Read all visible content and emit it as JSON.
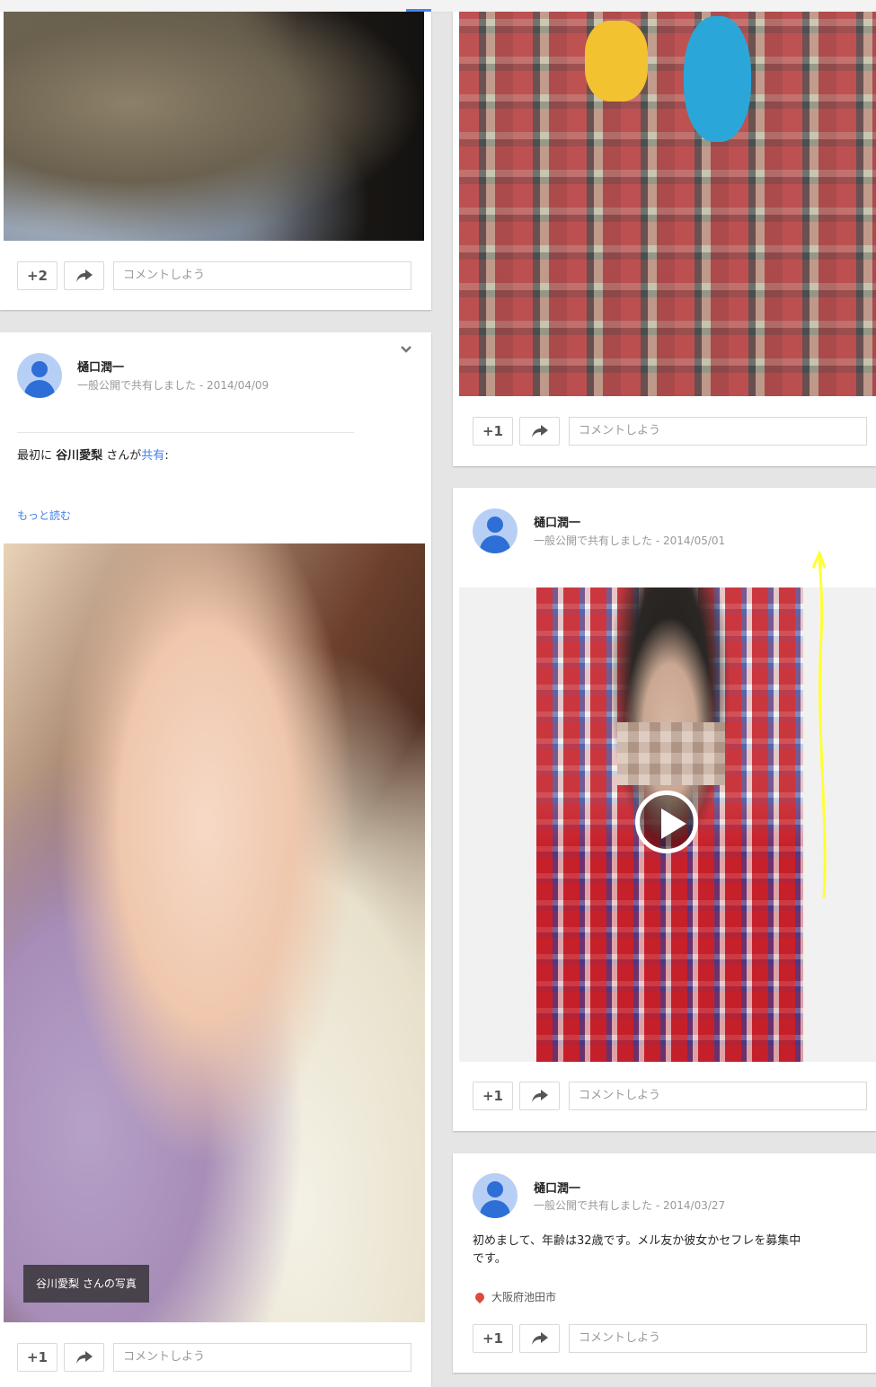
{
  "posts": {
    "p1": {
      "plus_label": "+2",
      "comment_placeholder": "コメントしよう"
    },
    "p2": {
      "plus_label": "+1",
      "comment_placeholder": "コメントしよう"
    },
    "p3": {
      "author": "樋口潤一",
      "visibility": "一般公開で共有しました",
      "date": "2014/04/09",
      "text_prefix": "最初に ",
      "text_name": "谷川愛梨",
      "text_middle": " さんが",
      "text_link": "共有",
      "text_suffix": ":",
      "read_more": "もっと読む",
      "photo_caption": "谷川愛梨 さんの写真",
      "plus_label": "+1",
      "comment_placeholder": "コメントしよう"
    },
    "p4": {
      "author": "樋口潤一",
      "visibility": "一般公開で共有しました",
      "date": "2014/05/01",
      "plus_label": "+1",
      "comment_placeholder": "コメントしよう"
    },
    "p5": {
      "author": "樋口潤一",
      "visibility": "一般公開で共有しました",
      "date": "2014/03/27",
      "text": "初めまして、年齢は32歳です。メル友か彼女かセフレを募集中です。",
      "location": "大阪府池田市",
      "plus_label": "+1",
      "comment_placeholder": "コメントしよう"
    }
  },
  "meta_separator": " - ",
  "colors": {
    "link": "#427fed",
    "annotation": "#ffff33",
    "pin": "#dd4b39"
  },
  "icons": [
    "share-arrow-icon",
    "chevron-down-icon",
    "avatar-icon",
    "play-icon",
    "location-pin-icon"
  ]
}
